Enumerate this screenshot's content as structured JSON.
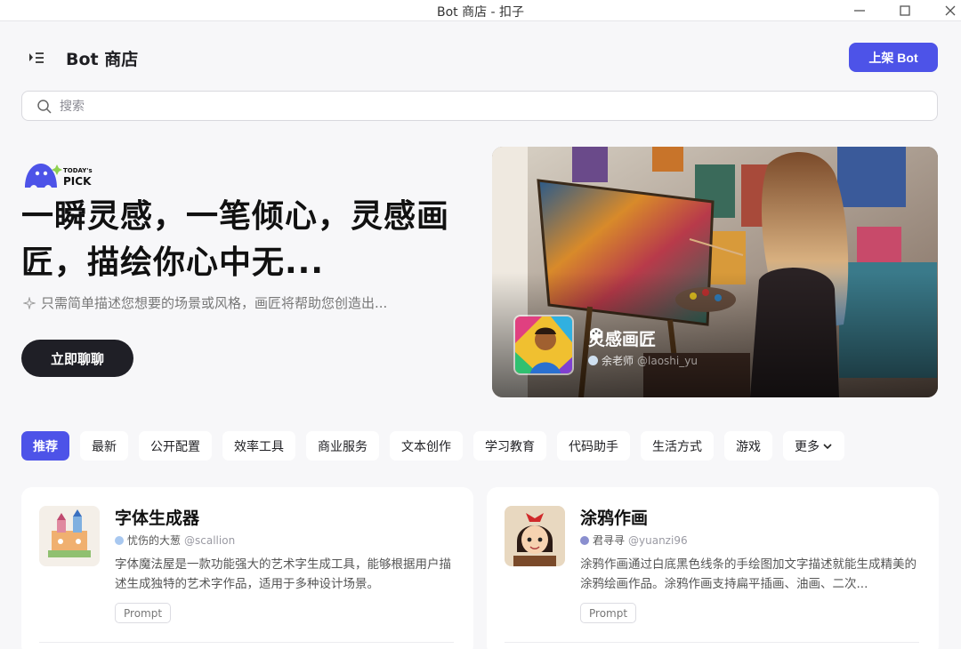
{
  "window": {
    "title": "Bot 商店 - 扣子"
  },
  "header": {
    "page_title": "Bot 商店",
    "publish_button": "上架 Bot"
  },
  "search": {
    "placeholder": "搜索"
  },
  "hero": {
    "badge_line1": "TODAY's",
    "badge_line2": "PICK",
    "title": "一瞬灵感，一笔倾心，灵感画匠，描绘你心中无...",
    "subtitle": "只需简单描述您想要的场景或风格，画匠将帮助您创造出...",
    "chat_button": "立即聊聊",
    "bot_name": "灵感画匠",
    "author_name": "余老师",
    "author_handle": "@laoshi_yu"
  },
  "tabs": [
    {
      "label": "推荐",
      "active": true
    },
    {
      "label": "最新"
    },
    {
      "label": "公开配置"
    },
    {
      "label": "效率工具"
    },
    {
      "label": "商业服务"
    },
    {
      "label": "文本创作"
    },
    {
      "label": "学习教育"
    },
    {
      "label": "代码助手"
    },
    {
      "label": "生活方式"
    },
    {
      "label": "游戏"
    },
    {
      "label": "更多"
    }
  ],
  "cards": [
    {
      "name": "字体生成器",
      "author_name": "忧伤的大葱",
      "author_handle": "@scallion",
      "description": "字体魔法屋是一款功能强大的艺术字生成工具，能够根据用户描述生成独特的艺术字作品，适用于多种设计场景。",
      "badge": "Prompt",
      "author_dot_color": "#a8c8f0"
    },
    {
      "name": "涂鸦作画",
      "author_name": "君寻寻",
      "author_handle": "@yuanzi96",
      "description": "涂鸦作画通过白底黑色线条的手绘图加文字描述就能生成精美的涂鸦绘画作品。涂鸦作画支持扁平插画、油画、二次...",
      "badge": "Prompt",
      "author_dot_color": "#8a8fcf"
    }
  ],
  "colors": {
    "accent": "#4d53e8",
    "dark_button": "#1f1f26"
  }
}
